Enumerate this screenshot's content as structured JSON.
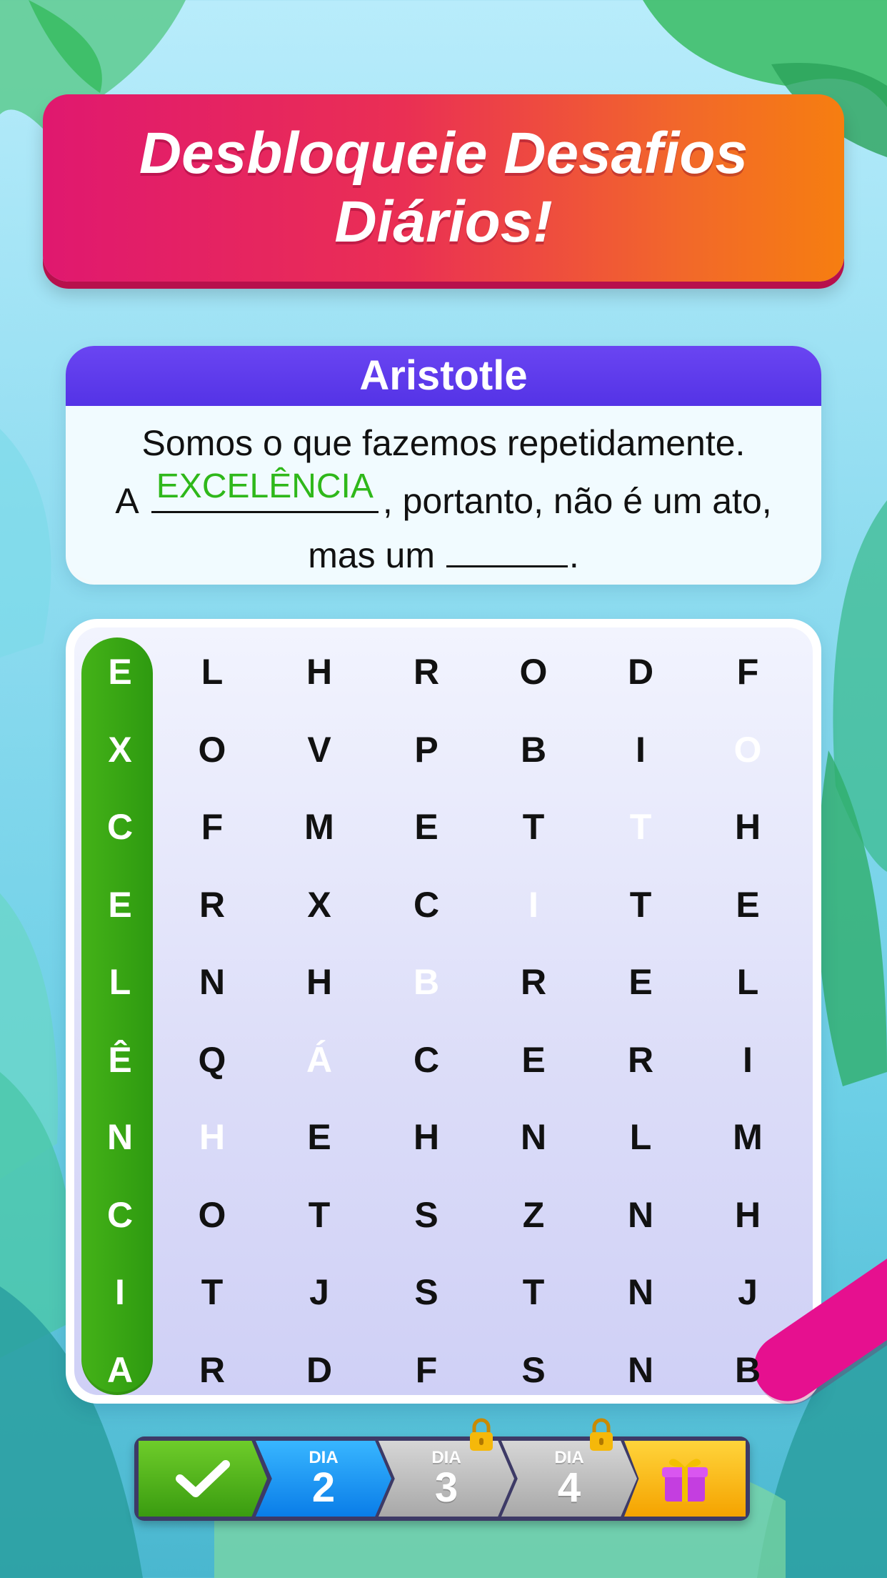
{
  "banner": {
    "title": "Desbloqueie Desafios Diários!"
  },
  "quote": {
    "author": "Aristotle",
    "line1": "Somos o que fazemos repetidamente.",
    "line2_prefix": "A",
    "answer_found": "EXCELÊNCIA",
    "line2_suffix": ", portanto, não é um ato,",
    "line3_prefix": "mas um",
    "line3_suffix": "."
  },
  "grid": {
    "rows": [
      [
        "E",
        "L",
        "H",
        "R",
        "O",
        "D",
        "F"
      ],
      [
        "X",
        "O",
        "V",
        "P",
        "B",
        "I",
        "O"
      ],
      [
        "C",
        "F",
        "M",
        "E",
        "T",
        "T",
        "H"
      ],
      [
        "E",
        "R",
        "X",
        "C",
        "I",
        "T",
        "E"
      ],
      [
        "L",
        "N",
        "H",
        "B",
        "R",
        "E",
        "L"
      ],
      [
        "Ê",
        "Q",
        "Á",
        "C",
        "E",
        "R",
        "I"
      ],
      [
        "N",
        "H",
        "E",
        "H",
        "N",
        "L",
        "M"
      ],
      [
        "C",
        "O",
        "T",
        "S",
        "Z",
        "N",
        "H"
      ],
      [
        "I",
        "T",
        "J",
        "S",
        "T",
        "N",
        "J"
      ],
      [
        "A",
        "R",
        "D",
        "F",
        "S",
        "N",
        "B"
      ]
    ],
    "found_word": "EXCELÊNCIA",
    "selecting_word": "HÁBITO",
    "found_color": "#3aa814",
    "selecting_color": "#e6108f"
  },
  "progress": {
    "completed_icon": "checkmark-icon",
    "days": [
      {
        "label": "DIA",
        "number": "2",
        "state": "current"
      },
      {
        "label": "DIA",
        "number": "3",
        "state": "locked"
      },
      {
        "label": "DIA",
        "number": "4",
        "state": "locked"
      }
    ],
    "reward_icon": "gift-icon"
  }
}
